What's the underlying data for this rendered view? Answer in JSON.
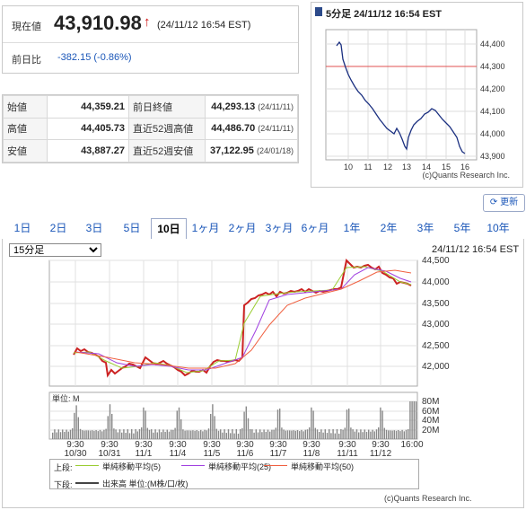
{
  "quote": {
    "current_label": "現在値",
    "current_price": "43,910.98",
    "arrow": "↑",
    "current_time": "(24/11/12 16:54 EST)",
    "change_label": "前日比",
    "change_value": "-382.15 (-0.86%)"
  },
  "stats": {
    "open_label": "始値",
    "open": "44,359.21",
    "prev_close_label": "前日終値",
    "prev_close": "44,293.13",
    "prev_close_date": "(24/11/11)",
    "high_label": "高値",
    "high": "44,405.73",
    "high52_label": "直近52週高値",
    "high52": "44,486.70",
    "high52_date": "(24/11/11)",
    "low_label": "安値",
    "low": "43,887.27",
    "low52_label": "直近52週安値",
    "low52": "37,122.95",
    "low52_date": "(24/01/18)"
  },
  "mini_chart": {
    "title": "5分足 24/11/12 16:54 EST",
    "x_labels": [
      "10",
      "11",
      "12",
      "13",
      "14",
      "15",
      "16"
    ],
    "y_labels": [
      "44,400",
      "44,300",
      "44,200",
      "44,100",
      "44,000",
      "43,900"
    ],
    "credit": "(c)Quants Research Inc."
  },
  "update_button": "更新",
  "tabs": [
    "1日",
    "2日",
    "3日",
    "5日",
    "10日",
    "1ヶ月",
    "2ヶ月",
    "3ヶ月",
    "6ヶ月",
    "1年",
    "2年",
    "3年",
    "5年",
    "10年"
  ],
  "active_tab": "10日",
  "interval_select": "15分足",
  "main_chart": {
    "timestamp": "24/11/12 16:54 EST",
    "y_labels": [
      "44,500",
      "44,000",
      "43,500",
      "43,000",
      "42,500",
      "42,000"
    ],
    "vol_unit": "単位: M",
    "vol_labels": [
      "80M",
      "60M",
      "40M",
      "20M"
    ],
    "x_time_labels": [
      "9:30",
      "9:30",
      "9:30",
      "9:30",
      "9:30",
      "9:30",
      "9:30",
      "9:30",
      "9:30",
      "9:30",
      "16:00"
    ],
    "x_date_labels": [
      "10/30",
      "10/31",
      "11/1",
      "11/4",
      "11/5",
      "11/6",
      "11/7",
      "11/8",
      "11/11",
      "11/12"
    ],
    "legend_upper_label": "上段:",
    "legend_ma5": "単純移動平均(5)",
    "legend_ma25": "単純移動平均(25)",
    "legend_ma50": "単純移動平均(50)",
    "legend_lower_label": "下段:",
    "legend_volume": "出来高 単位:(M株/口/枚)",
    "credit": "(c)Quants Research Inc.",
    "colors": {
      "ma5": "#9acd32",
      "ma25": "#a040e0",
      "ma50": "#f06040",
      "up": "#cc2222",
      "down": "#222222",
      "volume": "#888888"
    }
  }
}
